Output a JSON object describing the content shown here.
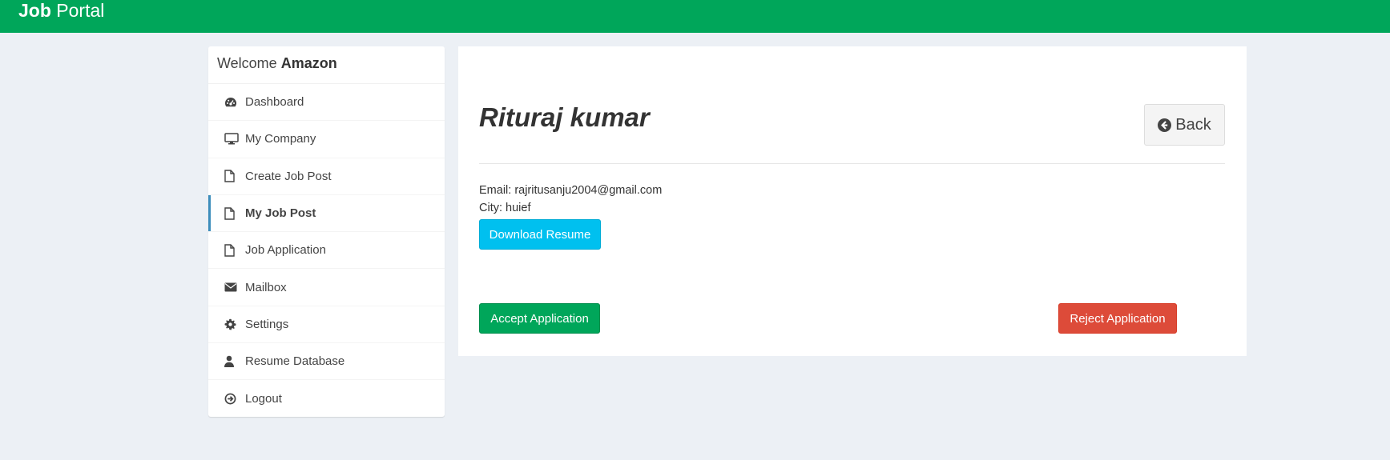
{
  "header": {
    "brand_bold": "Job",
    "brand_light": "Portal",
    "color": "#00a65a"
  },
  "sidebar": {
    "welcome_prefix": "Welcome",
    "company_name": "Amazon",
    "active_color": "#3c8dbc",
    "items": [
      {
        "label": "Dashboard",
        "icon": "dashboard-icon"
      },
      {
        "label": "My Company",
        "icon": "desktop-icon"
      },
      {
        "label": "Create Job Post",
        "icon": "file-icon"
      },
      {
        "label": "My Job Post",
        "icon": "file-icon",
        "active": true
      },
      {
        "label": "Job Application",
        "icon": "file-icon"
      },
      {
        "label": "Mailbox",
        "icon": "envelope-icon"
      },
      {
        "label": "Settings",
        "icon": "gear-icon"
      },
      {
        "label": "Resume Database",
        "icon": "user-icon"
      },
      {
        "label": "Logout",
        "icon": "logout-icon"
      }
    ]
  },
  "applicant": {
    "name": "Rituraj kumar",
    "email_line": "Email: rajritusanju2004@gmail.com",
    "city_line": "City: huief"
  },
  "actions": {
    "back_label": "Back",
    "download_label": "Download Resume",
    "accept_label": "Accept Application",
    "reject_label": "Reject Application"
  },
  "colors": {
    "info": "#00c0ef",
    "success": "#00a65a",
    "danger": "#dd4b39",
    "background": "#ecf0f5"
  }
}
